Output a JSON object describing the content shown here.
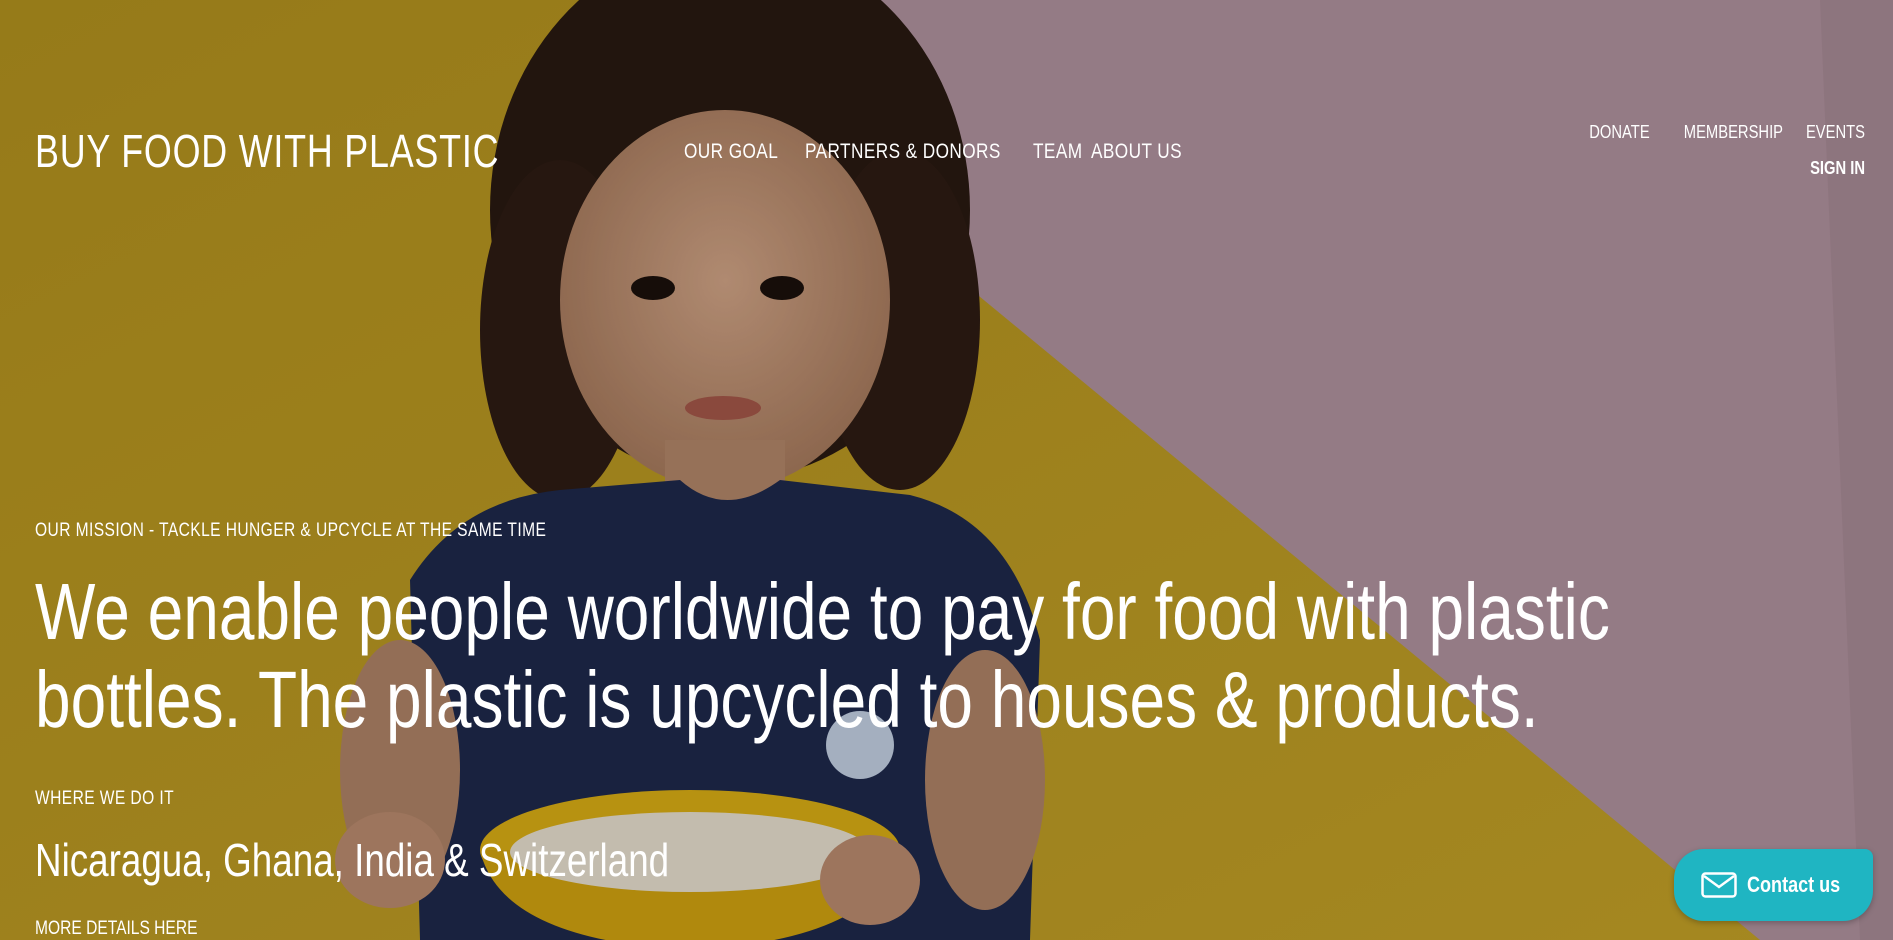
{
  "header": {
    "brand": "BUY FOOD WITH PLASTIC",
    "nav": [
      {
        "label": "OUR GOAL"
      },
      {
        "label": "PARTNERS & DONORS"
      },
      {
        "label": "TEAM"
      },
      {
        "label": "ABOUT US"
      }
    ],
    "utility": {
      "donate": "DONATE",
      "membership": "MEMBERSHIP",
      "events": "EVENTS",
      "signin": "SIGN IN"
    }
  },
  "hero": {
    "image_icon": "child-with-yellow-bowl-photo",
    "mission_label": "OUR MISSION - TACKLE HUNGER & UPCYCLE AT THE SAME TIME",
    "headline_line1": "We enable people worldwide to pay for food with plastic",
    "headline_line2": "bottles. The plastic is upcycled to houses & products.",
    "where_label": "WHERE WE DO IT",
    "where_value": "Nicaragua, Ghana, India & Switzerland",
    "more_link": "MORE DETAILS HERE"
  },
  "contact": {
    "label": "Contact us",
    "icon": "envelope-icon",
    "color": "#1fb5c2"
  },
  "colors": {
    "wall_yellow": "#c9a524",
    "wall_pink": "#b89aa6",
    "shirt_navy": "#1f2a4e",
    "bowl_yellow": "#e2b417"
  }
}
